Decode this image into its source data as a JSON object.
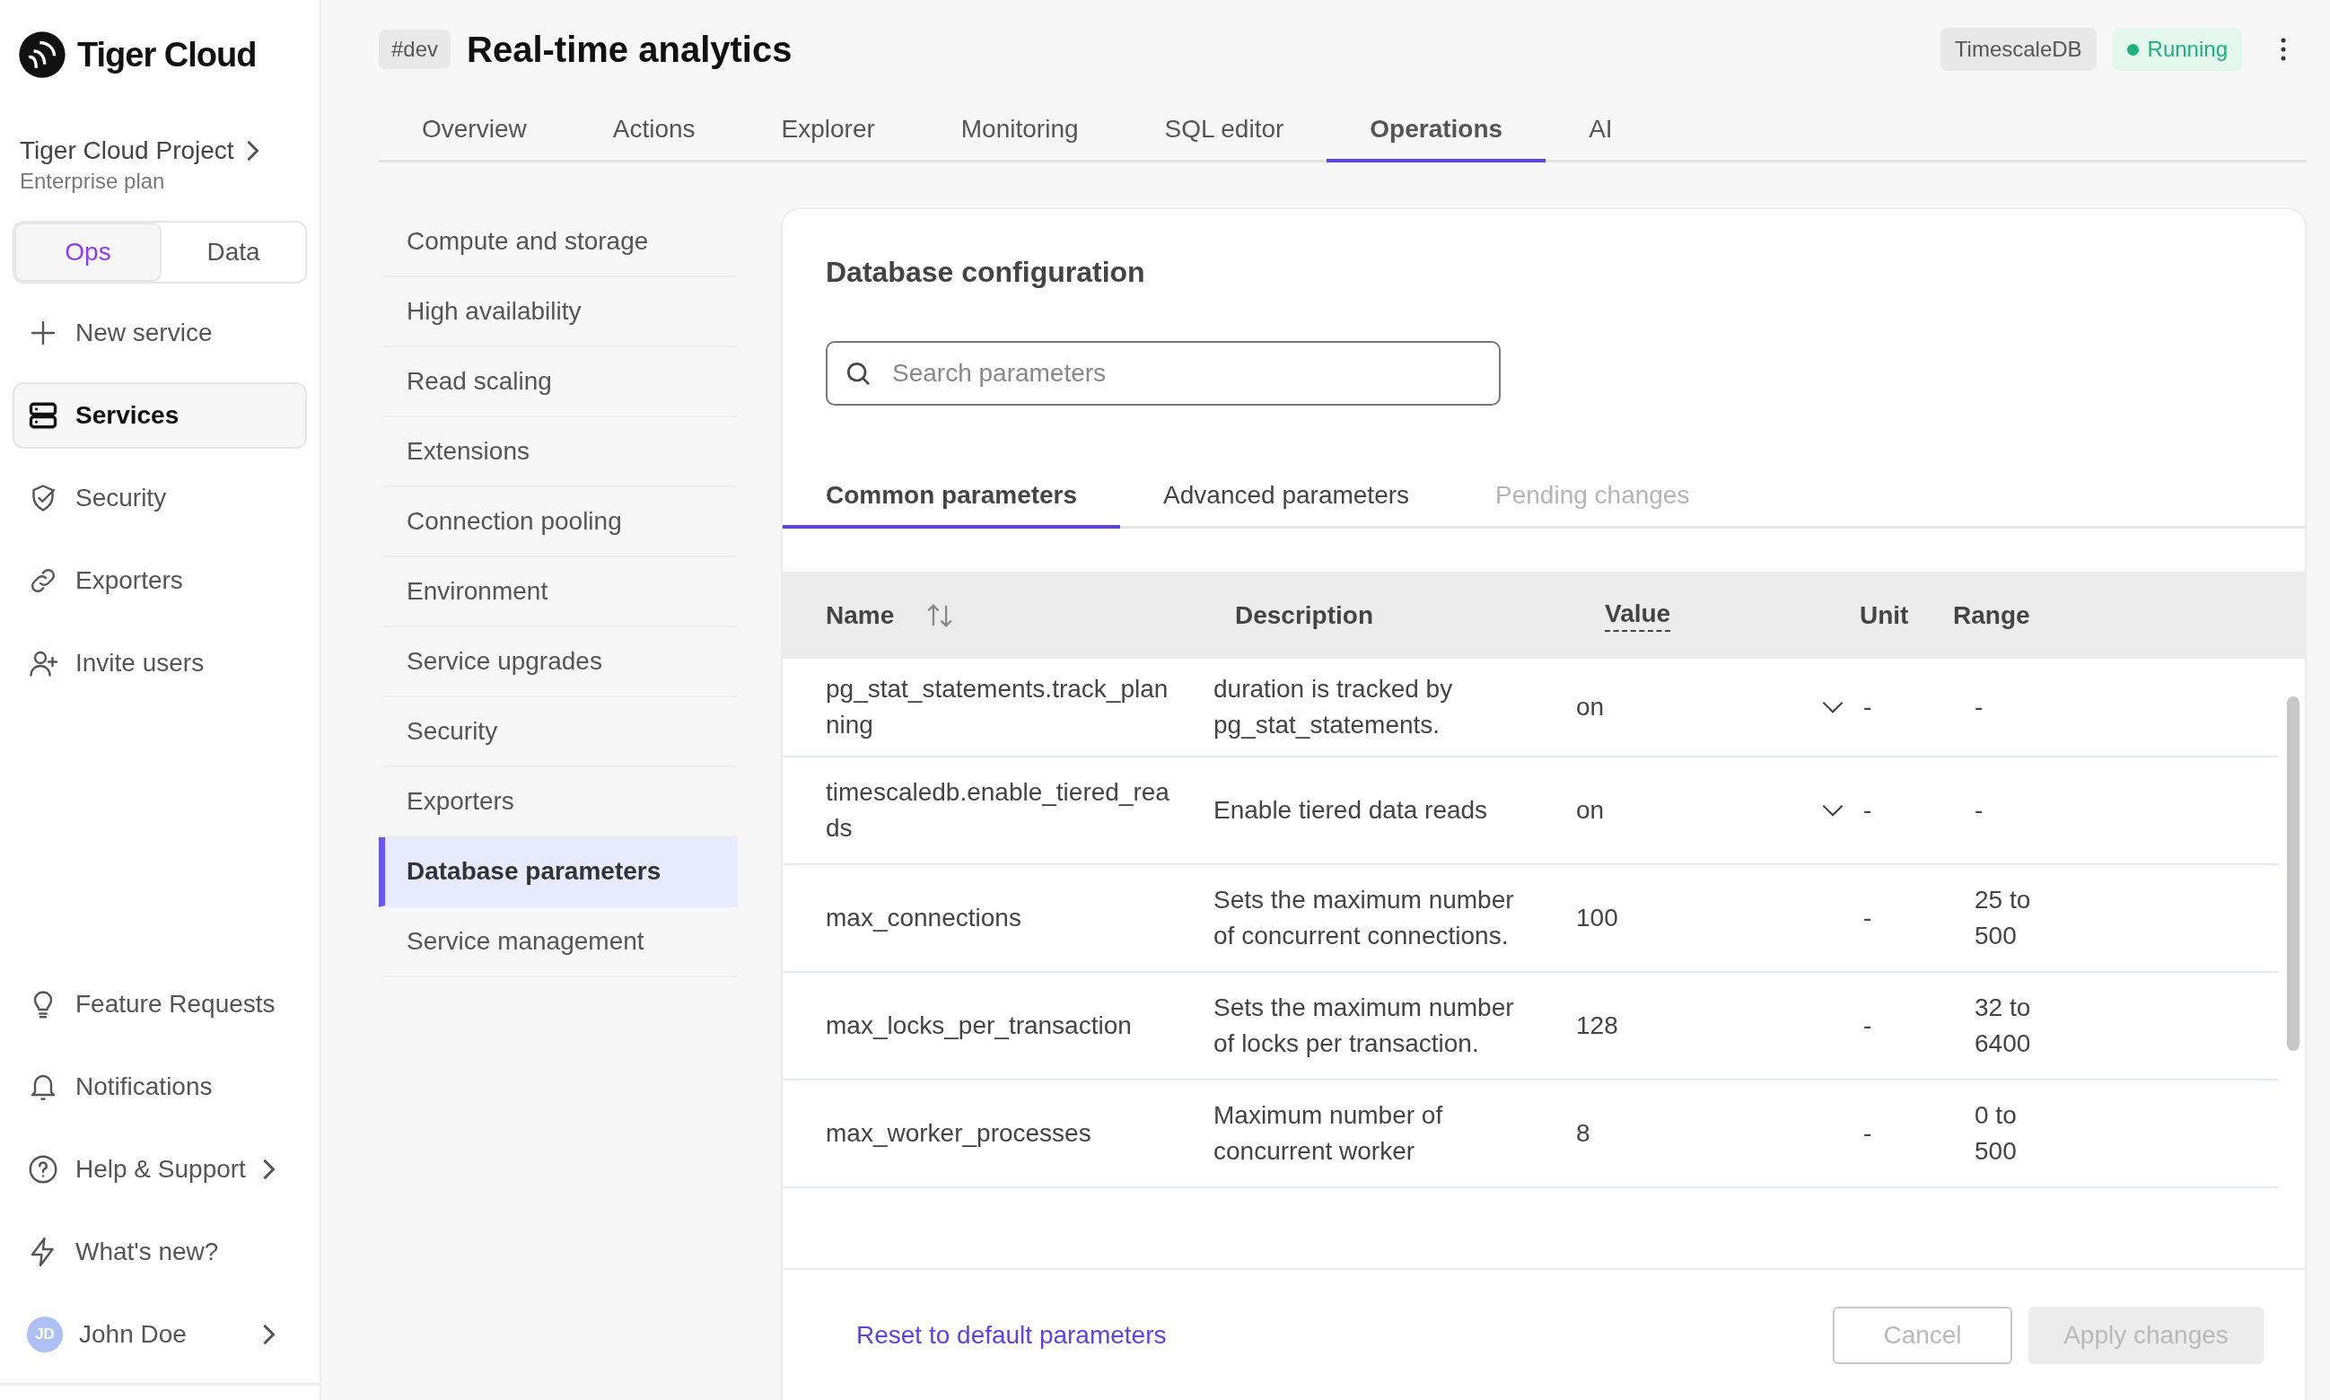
{
  "brand": {
    "name": "Tiger Cloud"
  },
  "project": {
    "name": "Tiger Cloud Project",
    "plan": "Enterprise plan"
  },
  "mode_switch": [
    {
      "label": "Ops",
      "selected": true
    },
    {
      "label": "Data",
      "selected": false
    }
  ],
  "nav": [
    {
      "label": "New service",
      "selected": false
    },
    {
      "label": "Services",
      "selected": true
    },
    {
      "label": "Security",
      "selected": false
    },
    {
      "label": "Exporters",
      "selected": false
    },
    {
      "label": "Invite users",
      "selected": false
    }
  ],
  "nav_bottom": [
    {
      "label": "Feature Requests",
      "chevron": false
    },
    {
      "label": "Notifications",
      "chevron": false
    },
    {
      "label": "Help & Support",
      "chevron": true
    },
    {
      "label": "What's new?",
      "chevron": false
    }
  ],
  "user": {
    "initials": "JD",
    "name": "John Doe"
  },
  "service": {
    "tag": "#dev",
    "title": "Real-time analytics",
    "engine": "TimescaleDB",
    "status": "Running"
  },
  "tabs": [
    {
      "label": "Overview",
      "selected": false
    },
    {
      "label": "Actions",
      "selected": false
    },
    {
      "label": "Explorer",
      "selected": false
    },
    {
      "label": "Monitoring",
      "selected": false
    },
    {
      "label": "SQL editor",
      "selected": false
    },
    {
      "label": "Operations",
      "selected": true
    },
    {
      "label": "AI",
      "selected": false
    }
  ],
  "subnav": [
    {
      "label": "Compute and storage",
      "selected": false
    },
    {
      "label": "High availability",
      "selected": false
    },
    {
      "label": "Read scaling",
      "selected": false
    },
    {
      "label": "Extensions",
      "selected": false
    },
    {
      "label": "Connection pooling",
      "selected": false
    },
    {
      "label": "Environment",
      "selected": false
    },
    {
      "label": "Service upgrades",
      "selected": false
    },
    {
      "label": "Security",
      "selected": false
    },
    {
      "label": "Exporters",
      "selected": false
    },
    {
      "label": "Database parameters",
      "selected": true
    },
    {
      "label": "Service management",
      "selected": false
    }
  ],
  "config": {
    "title": "Database configuration",
    "search": {
      "placeholder": "Search parameters"
    },
    "tabs": [
      {
        "label": "Common parameters",
        "selected": true,
        "disabled": false
      },
      {
        "label": "Advanced parameters",
        "selected": false,
        "disabled": false
      },
      {
        "label": "Pending changes",
        "selected": false,
        "disabled": true
      }
    ],
    "columns": [
      {
        "label": "Name",
        "sortable": true
      },
      {
        "label": "Description",
        "sortable": false
      },
      {
        "label": "Value",
        "sortable": false
      },
      {
        "label": "Unit",
        "sortable": false
      },
      {
        "label": "Range",
        "sortable": false
      }
    ],
    "rows": [
      {
        "name": "pg_stat_statements.track_planning",
        "description": "duration is tracked by pg_stat_statements.",
        "value": "on",
        "kind": "select",
        "unit": "-",
        "range": "-"
      },
      {
        "name": "timescaledb.enable_tiered_reads",
        "description": "Enable tiered data reads",
        "value": "on",
        "kind": "select",
        "unit": "-",
        "range": "-"
      },
      {
        "name": "max_connections",
        "description": "Sets the maximum number of concurrent connections.",
        "value": "100",
        "kind": "number",
        "unit": "-",
        "range": "25 to 500"
      },
      {
        "name": "max_locks_per_transaction",
        "description": "Sets the maximum number of locks per transaction.",
        "value": "128",
        "kind": "number",
        "unit": "-",
        "range": "32 to 6400"
      },
      {
        "name": "max_worker_processes",
        "description": "Maximum number of concurrent worker",
        "value": "8",
        "kind": "number",
        "unit": "-",
        "range": "0 to 500"
      }
    ],
    "footer": {
      "reset": "Reset to default parameters",
      "buttons": [
        {
          "label": "Cancel",
          "kind": "outline",
          "disabled": true
        },
        {
          "label": "Apply changes",
          "kind": "primary",
          "disabled": true
        }
      ]
    }
  }
}
